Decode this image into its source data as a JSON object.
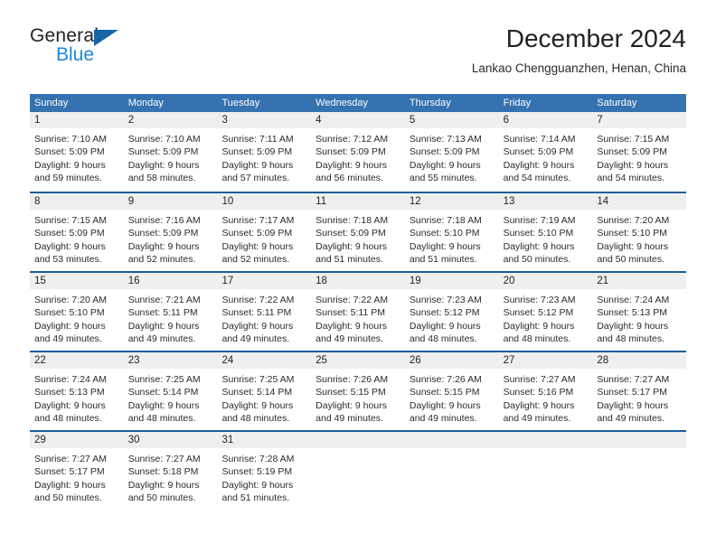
{
  "brand": {
    "name_part1": "General",
    "name_part2": "Blue",
    "accent_color": "#1e87d4",
    "triangle_color": "#1565a8"
  },
  "header": {
    "title": "December 2024",
    "subtitle": "Lankao Chengguanzhen, Henan, China"
  },
  "calendar": {
    "header_bg": "#3572b0",
    "row_rule_color": "#1c5f9e",
    "day_number_bg": "#efefef",
    "weekdays": [
      "Sunday",
      "Monday",
      "Tuesday",
      "Wednesday",
      "Thursday",
      "Friday",
      "Saturday"
    ],
    "weeks": [
      [
        {
          "day": "1",
          "sunrise": "Sunrise: 7:10 AM",
          "sunset": "Sunset: 5:09 PM",
          "daylight_line1": "Daylight: 9 hours",
          "daylight_line2": "and 59 minutes."
        },
        {
          "day": "2",
          "sunrise": "Sunrise: 7:10 AM",
          "sunset": "Sunset: 5:09 PM",
          "daylight_line1": "Daylight: 9 hours",
          "daylight_line2": "and 58 minutes."
        },
        {
          "day": "3",
          "sunrise": "Sunrise: 7:11 AM",
          "sunset": "Sunset: 5:09 PM",
          "daylight_line1": "Daylight: 9 hours",
          "daylight_line2": "and 57 minutes."
        },
        {
          "day": "4",
          "sunrise": "Sunrise: 7:12 AM",
          "sunset": "Sunset: 5:09 PM",
          "daylight_line1": "Daylight: 9 hours",
          "daylight_line2": "and 56 minutes."
        },
        {
          "day": "5",
          "sunrise": "Sunrise: 7:13 AM",
          "sunset": "Sunset: 5:09 PM",
          "daylight_line1": "Daylight: 9 hours",
          "daylight_line2": "and 55 minutes."
        },
        {
          "day": "6",
          "sunrise": "Sunrise: 7:14 AM",
          "sunset": "Sunset: 5:09 PM",
          "daylight_line1": "Daylight: 9 hours",
          "daylight_line2": "and 54 minutes."
        },
        {
          "day": "7",
          "sunrise": "Sunrise: 7:15 AM",
          "sunset": "Sunset: 5:09 PM",
          "daylight_line1": "Daylight: 9 hours",
          "daylight_line2": "and 54 minutes."
        }
      ],
      [
        {
          "day": "8",
          "sunrise": "Sunrise: 7:15 AM",
          "sunset": "Sunset: 5:09 PM",
          "daylight_line1": "Daylight: 9 hours",
          "daylight_line2": "and 53 minutes."
        },
        {
          "day": "9",
          "sunrise": "Sunrise: 7:16 AM",
          "sunset": "Sunset: 5:09 PM",
          "daylight_line1": "Daylight: 9 hours",
          "daylight_line2": "and 52 minutes."
        },
        {
          "day": "10",
          "sunrise": "Sunrise: 7:17 AM",
          "sunset": "Sunset: 5:09 PM",
          "daylight_line1": "Daylight: 9 hours",
          "daylight_line2": "and 52 minutes."
        },
        {
          "day": "11",
          "sunrise": "Sunrise: 7:18 AM",
          "sunset": "Sunset: 5:09 PM",
          "daylight_line1": "Daylight: 9 hours",
          "daylight_line2": "and 51 minutes."
        },
        {
          "day": "12",
          "sunrise": "Sunrise: 7:18 AM",
          "sunset": "Sunset: 5:10 PM",
          "daylight_line1": "Daylight: 9 hours",
          "daylight_line2": "and 51 minutes."
        },
        {
          "day": "13",
          "sunrise": "Sunrise: 7:19 AM",
          "sunset": "Sunset: 5:10 PM",
          "daylight_line1": "Daylight: 9 hours",
          "daylight_line2": "and 50 minutes."
        },
        {
          "day": "14",
          "sunrise": "Sunrise: 7:20 AM",
          "sunset": "Sunset: 5:10 PM",
          "daylight_line1": "Daylight: 9 hours",
          "daylight_line2": "and 50 minutes."
        }
      ],
      [
        {
          "day": "15",
          "sunrise": "Sunrise: 7:20 AM",
          "sunset": "Sunset: 5:10 PM",
          "daylight_line1": "Daylight: 9 hours",
          "daylight_line2": "and 49 minutes."
        },
        {
          "day": "16",
          "sunrise": "Sunrise: 7:21 AM",
          "sunset": "Sunset: 5:11 PM",
          "daylight_line1": "Daylight: 9 hours",
          "daylight_line2": "and 49 minutes."
        },
        {
          "day": "17",
          "sunrise": "Sunrise: 7:22 AM",
          "sunset": "Sunset: 5:11 PM",
          "daylight_line1": "Daylight: 9 hours",
          "daylight_line2": "and 49 minutes."
        },
        {
          "day": "18",
          "sunrise": "Sunrise: 7:22 AM",
          "sunset": "Sunset: 5:11 PM",
          "daylight_line1": "Daylight: 9 hours",
          "daylight_line2": "and 49 minutes."
        },
        {
          "day": "19",
          "sunrise": "Sunrise: 7:23 AM",
          "sunset": "Sunset: 5:12 PM",
          "daylight_line1": "Daylight: 9 hours",
          "daylight_line2": "and 48 minutes."
        },
        {
          "day": "20",
          "sunrise": "Sunrise: 7:23 AM",
          "sunset": "Sunset: 5:12 PM",
          "daylight_line1": "Daylight: 9 hours",
          "daylight_line2": "and 48 minutes."
        },
        {
          "day": "21",
          "sunrise": "Sunrise: 7:24 AM",
          "sunset": "Sunset: 5:13 PM",
          "daylight_line1": "Daylight: 9 hours",
          "daylight_line2": "and 48 minutes."
        }
      ],
      [
        {
          "day": "22",
          "sunrise": "Sunrise: 7:24 AM",
          "sunset": "Sunset: 5:13 PM",
          "daylight_line1": "Daylight: 9 hours",
          "daylight_line2": "and 48 minutes."
        },
        {
          "day": "23",
          "sunrise": "Sunrise: 7:25 AM",
          "sunset": "Sunset: 5:14 PM",
          "daylight_line1": "Daylight: 9 hours",
          "daylight_line2": "and 48 minutes."
        },
        {
          "day": "24",
          "sunrise": "Sunrise: 7:25 AM",
          "sunset": "Sunset: 5:14 PM",
          "daylight_line1": "Daylight: 9 hours",
          "daylight_line2": "and 48 minutes."
        },
        {
          "day": "25",
          "sunrise": "Sunrise: 7:26 AM",
          "sunset": "Sunset: 5:15 PM",
          "daylight_line1": "Daylight: 9 hours",
          "daylight_line2": "and 49 minutes."
        },
        {
          "day": "26",
          "sunrise": "Sunrise: 7:26 AM",
          "sunset": "Sunset: 5:15 PM",
          "daylight_line1": "Daylight: 9 hours",
          "daylight_line2": "and 49 minutes."
        },
        {
          "day": "27",
          "sunrise": "Sunrise: 7:27 AM",
          "sunset": "Sunset: 5:16 PM",
          "daylight_line1": "Daylight: 9 hours",
          "daylight_line2": "and 49 minutes."
        },
        {
          "day": "28",
          "sunrise": "Sunrise: 7:27 AM",
          "sunset": "Sunset: 5:17 PM",
          "daylight_line1": "Daylight: 9 hours",
          "daylight_line2": "and 49 minutes."
        }
      ],
      [
        {
          "day": "29",
          "sunrise": "Sunrise: 7:27 AM",
          "sunset": "Sunset: 5:17 PM",
          "daylight_line1": "Daylight: 9 hours",
          "daylight_line2": "and 50 minutes."
        },
        {
          "day": "30",
          "sunrise": "Sunrise: 7:27 AM",
          "sunset": "Sunset: 5:18 PM",
          "daylight_line1": "Daylight: 9 hours",
          "daylight_line2": "and 50 minutes."
        },
        {
          "day": "31",
          "sunrise": "Sunrise: 7:28 AM",
          "sunset": "Sunset: 5:19 PM",
          "daylight_line1": "Daylight: 9 hours",
          "daylight_line2": "and 51 minutes."
        },
        {
          "day": "",
          "sunrise": "",
          "sunset": "",
          "daylight_line1": "",
          "daylight_line2": ""
        },
        {
          "day": "",
          "sunrise": "",
          "sunset": "",
          "daylight_line1": "",
          "daylight_line2": ""
        },
        {
          "day": "",
          "sunrise": "",
          "sunset": "",
          "daylight_line1": "",
          "daylight_line2": ""
        },
        {
          "day": "",
          "sunrise": "",
          "sunset": "",
          "daylight_line1": "",
          "daylight_line2": ""
        }
      ]
    ]
  }
}
